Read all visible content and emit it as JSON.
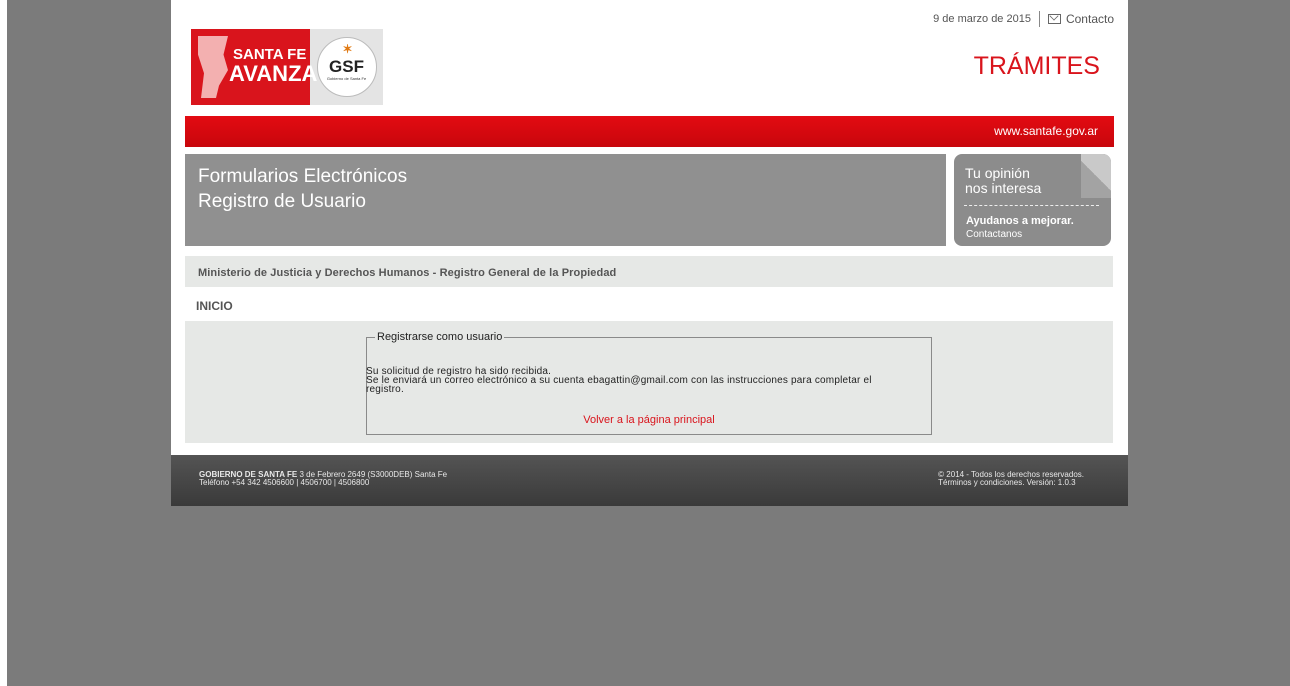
{
  "header": {
    "date": "9 de marzo de 2015",
    "contact_label": "Contacto",
    "section_title": "TRÁMITES",
    "logo_santa_fe_line1": "SANTA FE",
    "logo_santa_fe_line2": "AVANZA",
    "logo_gsf": "GSF",
    "logo_gsf_sub": "Gobierno de Santa Fe"
  },
  "redbar": {
    "site": "www.santafe.gov.ar"
  },
  "banner": {
    "line1": "Formularios Electrónicos",
    "line2": "Registro de Usuario"
  },
  "opinion": {
    "line1": "Tu opinión",
    "line2": "nos interesa",
    "cta": "Ayudanos a mejorar.",
    "link": "Contactanos"
  },
  "ministry": {
    "label": "Ministerio de Justicia y Derechos Humanos - Registro General de la Propiedad"
  },
  "breadcrumb": {
    "label": "INICIO"
  },
  "form": {
    "legend": "Registrarse como usuario",
    "message_line1": "Su solicitud de registro ha sido recibida.",
    "message_line2": "Se le enviará un correo electrónico a su cuenta ebagattin@gmail.com con las instrucciones para completar el",
    "message_line3": "registro.",
    "back_link": "Volver a la página principal"
  },
  "footer": {
    "org": "GOBIERNO DE SANTA FE",
    "address": " 3 de Febrero 2649 (S3000DEB) Santa Fe",
    "phone": "Teléfono +54 342 4506600 | 4506700 | 4506800",
    "copyright": "© 2014 - Todos los derechos reservados.",
    "terms": "Términos y condiciones. Versión: 1.0.3"
  },
  "colors": {
    "brand_red": "#d9141c",
    "background_gray": "#7b7b7b",
    "banner_gray": "#909090",
    "panel_gray": "#e6e8e6"
  }
}
